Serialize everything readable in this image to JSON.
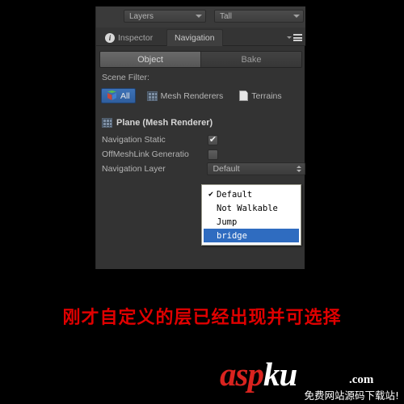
{
  "panel": {
    "toolbar": {
      "layers_dropdown": {
        "label": "Layers",
        "icon": "chevron-down-icon"
      },
      "layout_dropdown": {
        "label": "Tall",
        "icon": "chevron-down-icon"
      }
    },
    "tabs": [
      {
        "label": "Inspector",
        "icon": "info-icon",
        "active": false
      },
      {
        "label": "Navigation",
        "icon": "",
        "active": true
      }
    ],
    "panel_menu_icon": "hamburger-menu-icon",
    "modes": [
      {
        "label": "Object",
        "selected": true
      },
      {
        "label": "Bake",
        "selected": false
      }
    ],
    "scene_filter": {
      "label": "Scene Filter:",
      "options": [
        {
          "label": "All",
          "icon": "cube-icon",
          "selected": true
        },
        {
          "label": "Mesh Renderers",
          "icon": "mesh-renderer-icon",
          "selected": false
        },
        {
          "label": "Terrains",
          "icon": "terrain-icon",
          "selected": false
        }
      ]
    },
    "component": {
      "icon": "mesh-renderer-icon",
      "title": "Plane (Mesh Renderer)"
    },
    "properties": [
      {
        "name": "Navigation Static",
        "type": "checkbox",
        "checked": true,
        "mark": "✔"
      },
      {
        "name": "OffMeshLink Generatio",
        "type": "checkbox",
        "checked": false,
        "mark": ""
      }
    ],
    "navigation_layer": {
      "name": "Navigation Layer",
      "value": "Default"
    },
    "dropdown": {
      "items": [
        {
          "label": "Default",
          "checked": true,
          "tick": "✔",
          "highlighted": false
        },
        {
          "label": "Not Walkable",
          "checked": false,
          "tick": "",
          "highlighted": false
        },
        {
          "label": "Jump",
          "checked": false,
          "tick": "",
          "highlighted": false
        },
        {
          "label": "bridge",
          "checked": false,
          "tick": "",
          "highlighted": true
        }
      ]
    }
  },
  "caption": "刚才自定义的层已经出现并可选择",
  "logo": {
    "text_red": "asp",
    "text_white": "ku",
    "domain": ".com",
    "subtitle": "免费网站源码下载站!"
  },
  "colors": {
    "panel_bg": "#333333",
    "accent_blue": "#2f6cc0",
    "caption_red": "#e00000",
    "logo_red": "#d9231f"
  }
}
